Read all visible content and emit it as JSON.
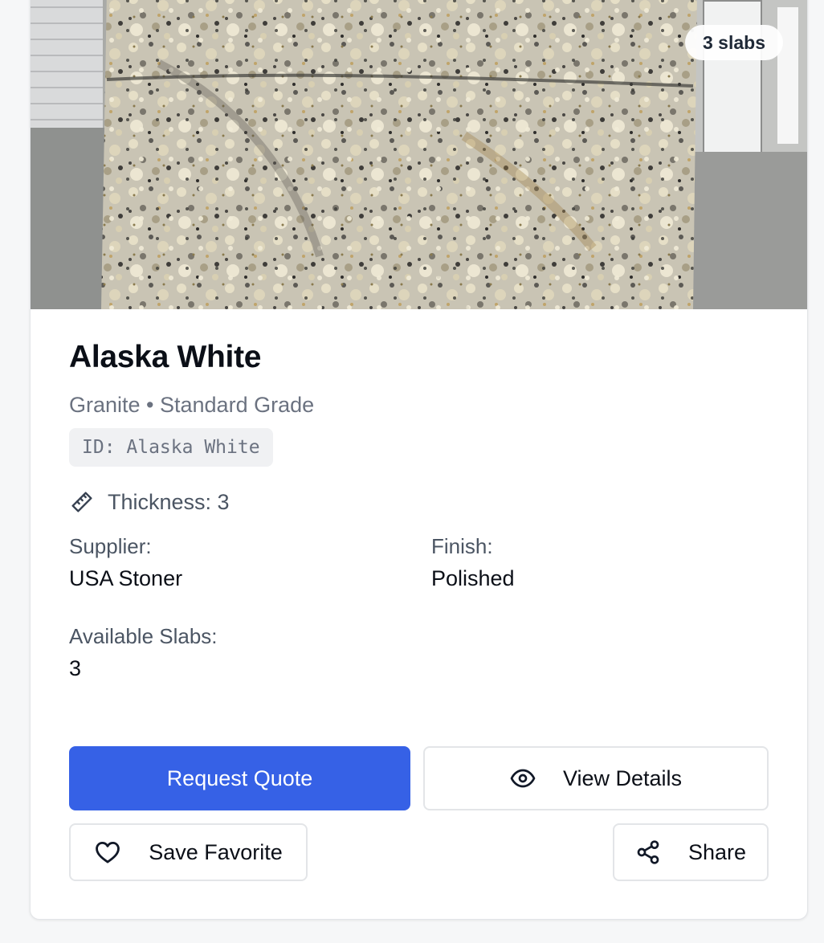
{
  "product": {
    "slab_count_badge": "3 slabs",
    "name": "Alaska White",
    "subtitle": "Granite • Standard Grade",
    "id_label": "ID: Alaska White",
    "thickness": "Thickness: 3",
    "supplier_label": "Supplier:",
    "supplier_value": "USA Stoner",
    "finish_label": "Finish:",
    "finish_value": "Polished",
    "available_label": "Available Slabs:",
    "available_value": "3"
  },
  "actions": {
    "request_quote": "Request Quote",
    "view_details": "View Details",
    "save_favorite": "Save Favorite",
    "share": "Share"
  },
  "icons": {
    "thickness": "ruler-icon",
    "view": "eye-icon",
    "favorite": "heart-icon",
    "share": "share-icon"
  },
  "colors": {
    "primary": "#3661e6",
    "border": "#e3e5e8",
    "muted_text": "#6b7280"
  }
}
